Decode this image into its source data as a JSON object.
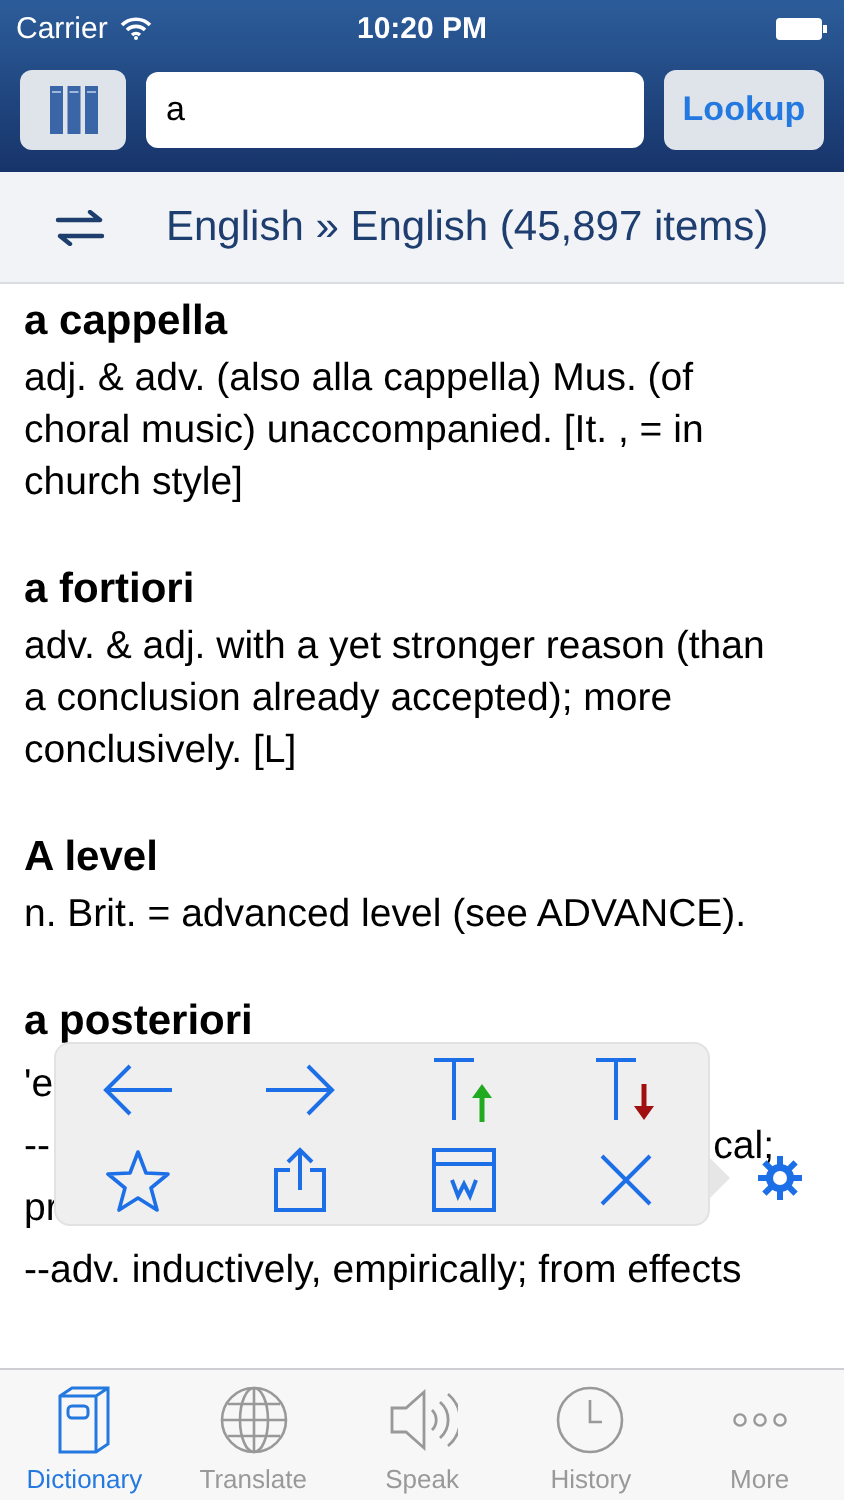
{
  "status_bar": {
    "carrier": "Carrier",
    "time": "10:20 PM"
  },
  "search": {
    "value": "a",
    "button": "Lookup"
  },
  "language_bar": {
    "label": "English » English (45,897 items)"
  },
  "entries": [
    {
      "headword": "a cappella",
      "lines": [
        "adj. & adv. (also alla cappella) Mus. (of choral music) unaccompanied. [It. , = in church style]"
      ]
    },
    {
      "headword": "a fortiori",
      "lines": [
        "adv. & adj. with a yet stronger reason (than a conclusion already accepted); more conclusively. [L]"
      ]
    },
    {
      "headword": "A level",
      "lines": [
        "n. Brit. = advanced level (see ADVANCE)."
      ]
    },
    {
      "headword": "a posteriori",
      "fragments": [
        {
          "left": "'e"
        },
        {
          "left": "--",
          "right": "cal;"
        },
        {
          "left": "pr"
        },
        {
          "left": "--adv. inductively, empirically; from effects"
        }
      ]
    }
  ],
  "toolbar_popup": {
    "kind": "popup"
  },
  "tabs": [
    {
      "label": "Dictionary",
      "selected": true
    },
    {
      "label": "Translate",
      "selected": false
    },
    {
      "label": "Speak",
      "selected": false
    },
    {
      "label": "History",
      "selected": false
    },
    {
      "label": "More",
      "selected": false
    }
  ]
}
